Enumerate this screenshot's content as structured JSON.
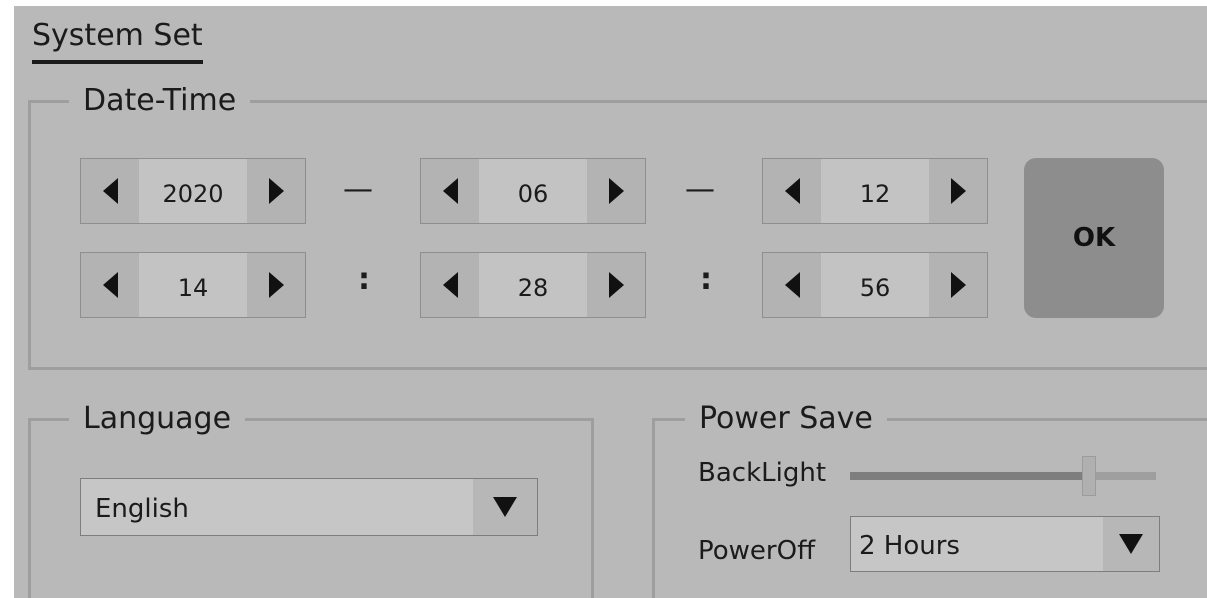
{
  "page_title": "System Set",
  "date_time": {
    "legend": "Date-Time",
    "date": {
      "year": "2020",
      "month": "06",
      "day": "12",
      "separator": "—"
    },
    "time": {
      "hour": "14",
      "minute": "28",
      "second": "56",
      "separator": ":"
    },
    "ok_label": "OK"
  },
  "language": {
    "legend": "Language",
    "selected": "English"
  },
  "power_save": {
    "legend": "Power Save",
    "backlight_label": "BackLight",
    "backlight_level": 0.78,
    "poweroff_label": "PowerOff",
    "poweroff_selected": "2 Hours"
  },
  "icons": {
    "decrement": "triangle-left-icon",
    "increment": "triangle-right-icon",
    "dropdown": "triangle-down-icon"
  }
}
